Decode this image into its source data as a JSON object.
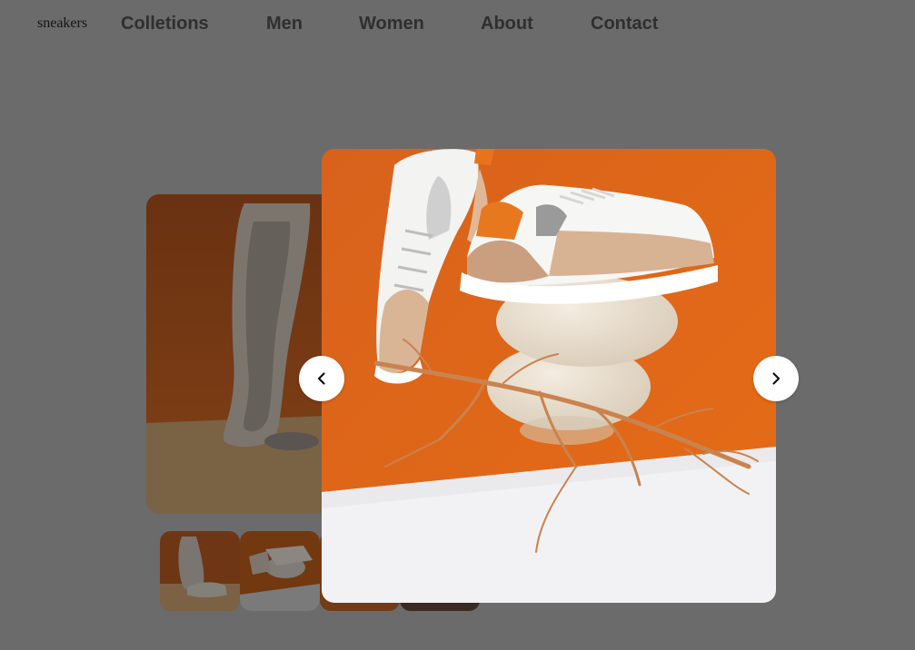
{
  "header": {
    "logo": "sneakers",
    "nav": [
      {
        "label": "Colletions"
      },
      {
        "label": "Men"
      },
      {
        "label": "Women"
      },
      {
        "label": "About"
      },
      {
        "label": "Contact"
      }
    ]
  },
  "gallery": {
    "main_image": "sneaker-sole-photo",
    "thumbnails": [
      "thumbnail-1",
      "thumbnail-2",
      "thumbnail-3",
      "thumbnail-4"
    ]
  },
  "lightbox": {
    "image": "sneakers-on-stones-with-branch-photo",
    "prev_icon": "chevron-left-icon",
    "next_icon": "chevron-right-icon"
  },
  "colors": {
    "overlay": "#6b6b6b",
    "orange": "#e0681a",
    "tan": "#d8b596"
  }
}
